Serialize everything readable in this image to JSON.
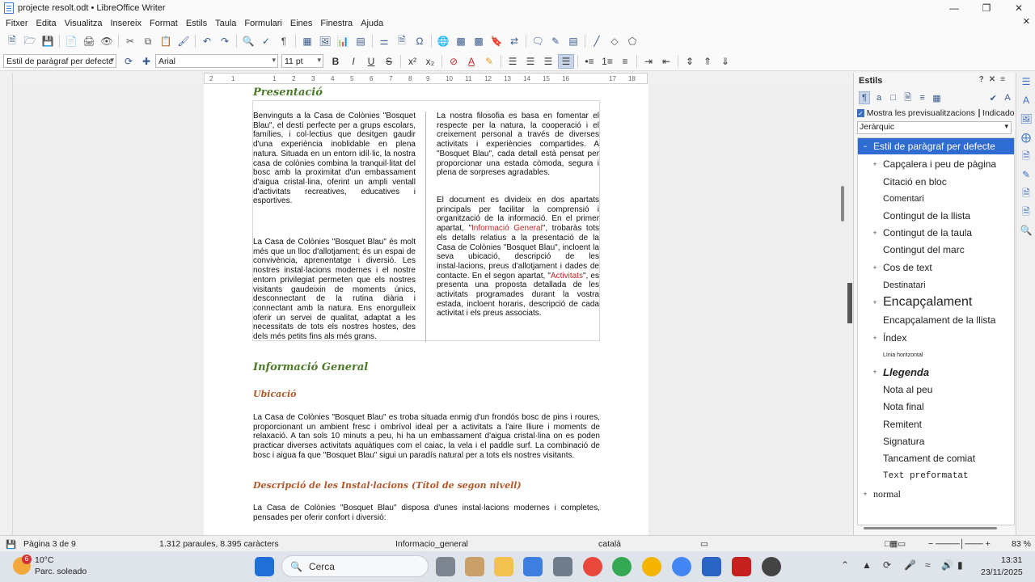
{
  "window": {
    "title": "projecte resolt.odt • LibreOffice Writer"
  },
  "menu": [
    "Fitxer",
    "Edita",
    "Visualitza",
    "Insereix",
    "Format",
    "Estils",
    "Taula",
    "Formulari",
    "Eines",
    "Finestra",
    "Ajuda"
  ],
  "format_toolbar": {
    "paragraph_style": "Estil de paràgraf per defecte",
    "font_name": "Arial",
    "font_size": "11 pt"
  },
  "ruler": {
    "ticks": [
      "2",
      "1",
      "1",
      "2",
      "3",
      "4",
      "5",
      "6",
      "7",
      "8",
      "9",
      "10",
      "11",
      "12",
      "13",
      "14",
      "15",
      "16",
      "17",
      "18"
    ]
  },
  "document": {
    "heading_presentacio": "Presentació",
    "col1_p1": "Benvinguts a la Casa de Colònies \"Bosquet Blau\", el destí perfecte per a grups escolars, famílies, i col·lectius que desitgen gaudir d'una experiència inoblidable en plena natura. Situada en un entorn idíl·lic, la nostra casa de colònies combina la tranquil·litat del bosc amb la proximitat d'un embassament d'aigua cristal·lina, oferint un ampli ventall d'activitats recreatives, educatives i esportives.",
    "col1_p2": "La Casa de Colònies \"Bosquet Blau\" és molt més que un lloc d'allotjament; és un espai de convivència, aprenentatge i diversió. Les nostres instal·lacions modernes i el nostre entorn privilegiat permeten que els nostres visitants gaudeixin de moments únics, desconnectant de la rutina diària i connectant amb la natura. Ens enorgulleix oferir un servei de qualitat, adaptat a les necessitats de tots els nostres hostes, des dels més petits fins als més grans.",
    "col2_p1": "La nostra filosofia es basa en fomentar el respecte per la natura, la cooperació i el creixement personal a través de diverses activitats i experiències compartides. A \"Bosquet Blau\", cada detall està pensat per proporcionar una estada còmoda, segura i plena de sorpreses agradables.",
    "col2_p2_a": "El document es divideix en dos apartats principals per facilitar la comprensió i organització de la informació. En el primer apartat, \"",
    "col2_link1": "Informació General",
    "col2_p2_b": "\", trobaràs tots els detalls relatius a la presentació de la Casa de Colònies \"Bosquet Blau\", incloent la seva ubicació, descripció de les instal·lacions, preus d'allotjament i dades de contacte. En el segon apartat, \"",
    "col2_link2": "Activitats",
    "col2_p2_c": "\", es presenta una proposta detallada de les activitats programades durant la vostra estada, incloent horaris, descripció de cada activitat i els preus associats.",
    "heading_info": "Informació General",
    "heading_ubicacio": "Ubicació",
    "ubicacio_text": "La Casa de Colònies \"Bosquet Blau\" es troba situada enmig d'un frondós bosc de pins i roures, proporcionant un ambient fresc i ombrívol ideal per a activitats a l'aire lliure i moments de relaxació. A tan sols 10 minuts a peu, hi ha un embassament d'aigua cristal·lina on es poden practicar diverses activitats aquàtiques com el caiac, la vela i el paddle surf. La combinació de bosc i aigua fa que \"Bosquet Blau\" sigui un paradís natural per a tots els nostres visitants.",
    "heading_descripcio": "Descripció de les Instal·lacions (Títol de segon nivell)",
    "descripcio_text": "La Casa de Colònies \"Bosquet Blau\" disposa d'unes instal·lacions modernes i completes, pensades per oferir confort i diversió:"
  },
  "sidebar": {
    "title": "Estils",
    "show_previews": "Mostra les previsualitzacions",
    "indicators": "Indicadors",
    "filter": "Jeràrquic",
    "styles": [
      {
        "label": "Estil de paràgraf per defecte",
        "expander": "−",
        "selected": true
      },
      {
        "label": "Capçalera i peu de pàgina",
        "expander": "+"
      },
      {
        "label": "Citació en bloc",
        "expander": ""
      },
      {
        "label": "Comentari",
        "expander": ""
      },
      {
        "label": "Contingut de la llista",
        "expander": ""
      },
      {
        "label": "Contingut de la taula",
        "expander": "+"
      },
      {
        "label": "Contingut del marc",
        "expander": ""
      },
      {
        "label": "Cos de text",
        "expander": "+"
      },
      {
        "label": "Destinatari",
        "expander": ""
      },
      {
        "label": "Encapçalament",
        "expander": "+"
      },
      {
        "label": "Encapçalament de la llista",
        "expander": ""
      },
      {
        "label": "Índex",
        "expander": "+"
      },
      {
        "label": "Línia horitzontal",
        "expander": ""
      },
      {
        "label": "Llegenda",
        "expander": "+"
      },
      {
        "label": "Nota al peu",
        "expander": ""
      },
      {
        "label": "Nota final",
        "expander": ""
      },
      {
        "label": "Remitent",
        "expander": ""
      },
      {
        "label": "Signatura",
        "expander": ""
      },
      {
        "label": "Tancament de comiat",
        "expander": ""
      },
      {
        "label": "Text preformatat",
        "expander": ""
      },
      {
        "label": "normal",
        "expander": "+"
      }
    ]
  },
  "statusbar": {
    "page": "Pàgina 3 de 9",
    "words": "1.312 paraules, 8.395 caràcters",
    "page_style": "Informacio_general",
    "language": "català",
    "zoom": "83 %"
  },
  "taskbar": {
    "temperature": "10°C",
    "weather": "Parc. soleado",
    "badge": "6",
    "search": "Cerca",
    "time": "13:31",
    "date": "23/11/2025"
  }
}
